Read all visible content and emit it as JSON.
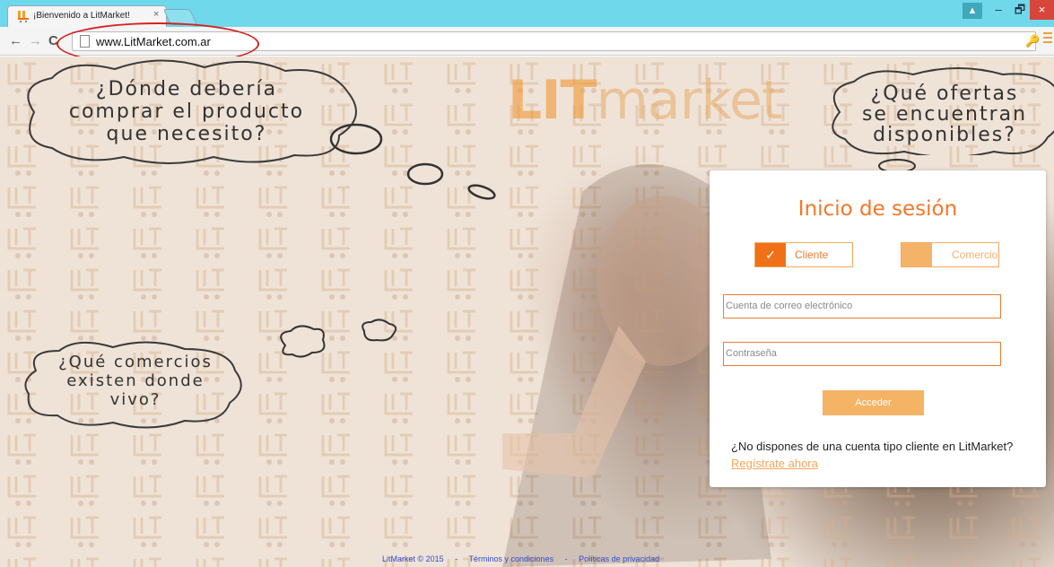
{
  "browser": {
    "tab_title": "¡Bienvenido a LitMarket!",
    "tab_close": "×",
    "url": "www.LitMarket.com.ar",
    "nav_back": "←",
    "nav_forward": "→",
    "nav_reload": "C",
    "key_icon": "🔑",
    "window_user": "▲",
    "window_min": "–",
    "window_max": "🗗",
    "window_close": "×"
  },
  "logo": {
    "mark": "LIT",
    "text": "market"
  },
  "bubbles": {
    "top_left": [
      "¿Dónde debería",
      "comprar el producto",
      "que necesito?"
    ],
    "top_right": [
      "¿Qué ofertas",
      "se encuentran",
      "disponibles?"
    ],
    "bottom_left": [
      "¿Qué comercios",
      "existen donde",
      "vivo?"
    ]
  },
  "login": {
    "title": "Inicio de sesión",
    "cliente_label": "Cliente",
    "comercio_label": "Comercio",
    "check_mark": "✓",
    "email_placeholder": "Cuenta de correo electrónico",
    "password_placeholder": "Contraseña",
    "submit_label": "Acceder",
    "signup_question": "¿No dispones de una cuenta tipo cliente en LitMarket?",
    "signup_link": "Regístrate ahora"
  },
  "footer": {
    "copyright": "LitMarket © 2015",
    "separator": "-",
    "terms": "Términos y condiciones",
    "privacy": "Políticas de privacidad"
  },
  "colors": {
    "accent": "#f07018",
    "accent_light": "#f5b366",
    "titlebar": "#6fd8ea",
    "annotation": "#d62020",
    "footer_link": "#2f4ccf"
  },
  "icons": {
    "favicon": "litmarket-favicon",
    "page": "page-icon",
    "menu": "menu-icon"
  }
}
